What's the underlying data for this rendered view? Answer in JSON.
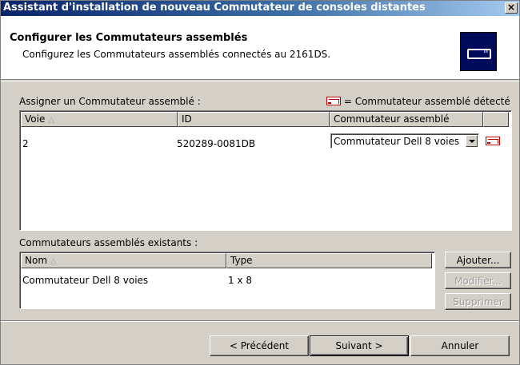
{
  "window": {
    "title": "Assistant d'installation de nouveau Commutateur de consoles distantes",
    "close_glyph": "×"
  },
  "header": {
    "title": "Configurer les Commutateurs assemblés",
    "subtitle": "Configurez les Commutateurs assemblés connectés au 2161DS.",
    "icon": "switch-device-icon"
  },
  "assign": {
    "label": "Assigner un Commutateur assemblé :",
    "legend_text": "= Commutateur assemblé détecté",
    "legend_icon": "detected-switch-icon",
    "columns": [
      "Voie",
      "ID",
      "Commutateur assemblé",
      ""
    ],
    "sort_indicator": "△",
    "rows": [
      {
        "voie": "2",
        "id": "520289-0081DB",
        "switch": "Commutateur Dell 8 voies"
      }
    ]
  },
  "existing": {
    "label": "Commutateurs assemblés existants :",
    "columns": [
      "Nom",
      "Type"
    ],
    "sort_indicator": "△",
    "rows": [
      {
        "name": "Commutateur Dell 8 voies",
        "type": "1 x 8"
      }
    ],
    "buttons": {
      "add": "Ajouter...",
      "modify": "Modifier...",
      "delete": "Supprimer"
    }
  },
  "nav": {
    "previous": "< Précédent",
    "next": "Suivant >",
    "cancel": "Annuler"
  },
  "colors": {
    "title_gradient_start": "#0a246a",
    "title_gradient_end": "#a6caf0",
    "face": "#d4d0c8",
    "detected_icon": "#c00000"
  }
}
